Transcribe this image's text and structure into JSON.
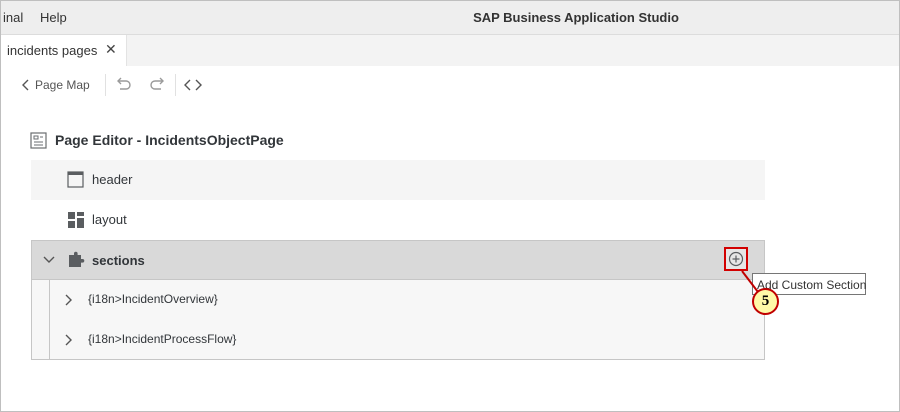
{
  "menubar": {
    "items": [
      "inal",
      "Help"
    ],
    "app_title": "SAP Business Application Studio"
  },
  "tabs": [
    {
      "label": "incidents pages",
      "close": "✕"
    }
  ],
  "toolbar": {
    "page_map_label": "Page Map"
  },
  "editor": {
    "title": "Page Editor - IncidentsObjectPage",
    "rows": {
      "header": "header",
      "layout": "layout",
      "sections": "sections"
    },
    "section_children": [
      "{i18n>IncidentOverview}",
      "{i18n>IncidentProcessFlow}"
    ],
    "add_tooltip": "Add Custom Section"
  },
  "callout": {
    "number": "5"
  },
  "colors": {
    "highlight_border": "#d20000",
    "callout_fill": "#fff9a8"
  }
}
